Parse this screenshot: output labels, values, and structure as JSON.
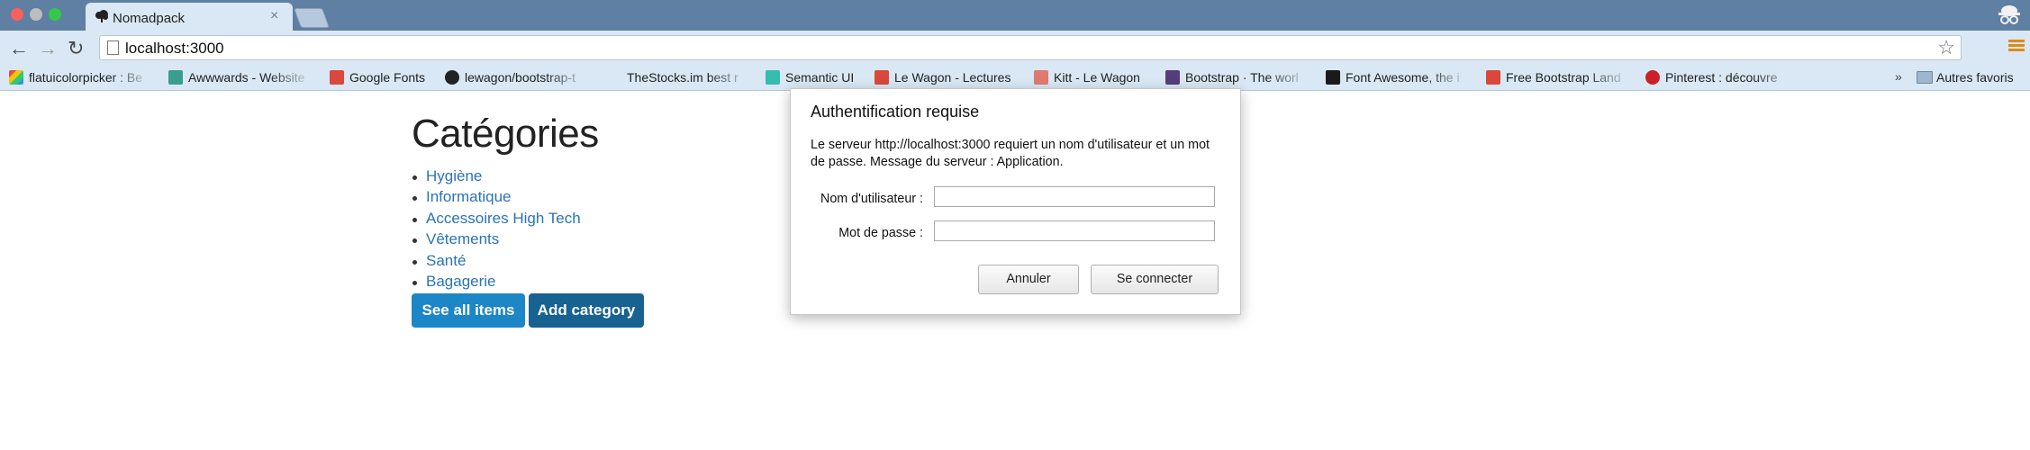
{
  "browser": {
    "tab": {
      "title": "Nomadpack",
      "close": "×"
    },
    "nav": {
      "back": "←",
      "forward": "→",
      "reload": "↻"
    },
    "address": {
      "url": "localhost:3000"
    },
    "star": "☆",
    "bookmarks": [
      {
        "label": "flatuicolorpicker : Be",
        "icon_color": "#e74c3c"
      },
      {
        "label": "Awwwards - Website",
        "icon_color": "#3a9e8e"
      },
      {
        "label": "Google Fonts",
        "icon_color": "#d9483b"
      },
      {
        "label": "lewagon/bootstrap-t",
        "icon_color": "#222222"
      },
      {
        "label": "TheStocks.im best r",
        "icon_color": "#d9e8f4"
      },
      {
        "label": "Semantic UI",
        "icon_color": "#35bdb2"
      },
      {
        "label": "Le Wagon - Lectures",
        "icon_color": "#d9483b"
      },
      {
        "label": "Kitt - Le Wagon",
        "icon_color": "#e07a70"
      },
      {
        "label": "Bootstrap · The worl",
        "icon_color": "#563d7c"
      },
      {
        "label": "Font Awesome, the i",
        "icon_color": "#1a1a1a"
      },
      {
        "label": "Free Bootstrap Land",
        "icon_color": "#d9483b"
      },
      {
        "label": "Pinterest : découvre",
        "icon_color": "#cb2027"
      }
    ],
    "more": "»",
    "other_bookmarks": "Autres favoris"
  },
  "page": {
    "title": "Catégories",
    "categories": [
      "Hygiène",
      "Informatique",
      "Accessoires High Tech",
      "Vêtements",
      "Santé",
      "Bagagerie"
    ],
    "see_all_label": "See all items",
    "add_category_label": "Add category",
    "colors": {
      "link": "#2a73b8",
      "btn_primary": "#1c86c6",
      "btn_dark": "#176291"
    }
  },
  "dialog": {
    "title": "Authentification requise",
    "message": "Le serveur http://localhost:3000 requiert un nom d'utilisateur et un mot de passe. Message du serveur : Application.",
    "username_label": "Nom d'utilisateur :",
    "password_label": "Mot de passe :",
    "username_value": "",
    "password_value": "",
    "cancel_label": "Annuler",
    "login_label": "Se connecter"
  }
}
